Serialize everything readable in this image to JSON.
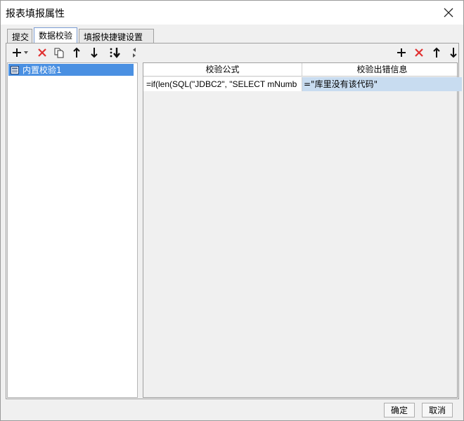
{
  "window": {
    "title": "报表填报属性"
  },
  "tabs": [
    {
      "label": "提交"
    },
    {
      "label": "数据校验"
    },
    {
      "label": "填报快捷键设置"
    }
  ],
  "left_toolbar": {
    "icons": [
      "add-icon",
      "dropdown-arrow-icon",
      "delete-icon",
      "copy-icon",
      "move-up-icon",
      "move-down-icon",
      "sort-icon",
      "collapse-arrows-icon"
    ]
  },
  "validation_list": {
    "items": [
      {
        "label": "内置校验1",
        "icon": "validation-item-icon"
      }
    ]
  },
  "right_toolbar": {
    "icons": [
      "add-icon",
      "delete-icon",
      "move-up-icon",
      "move-down-icon"
    ]
  },
  "table": {
    "columns": [
      "校验公式",
      "校验出错信息"
    ],
    "rows": [
      {
        "formula": "=if(len(SQL(\"JDBC2\", \"SELECT mNumb",
        "message": "=\"库里没有该代码\""
      }
    ]
  },
  "buttons": {
    "ok": "确定",
    "cancel": "取消"
  },
  "colors": {
    "selection": "#4a90e2",
    "delete_red": "#e03030",
    "row_highlight": "#c8dcf0"
  }
}
